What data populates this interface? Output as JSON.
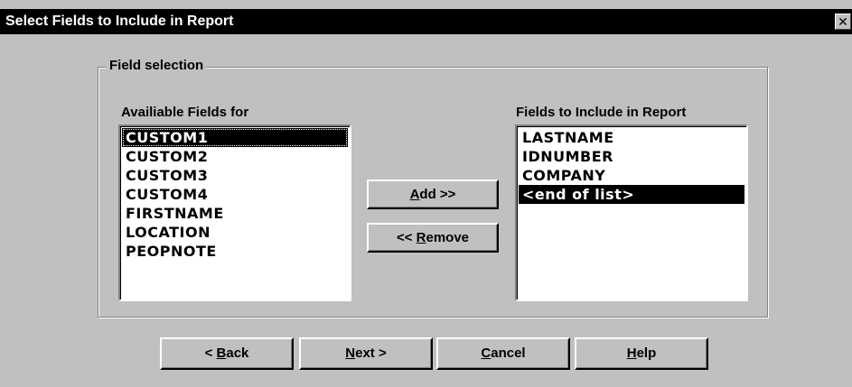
{
  "window": {
    "title": "Select Fields to Include in Report",
    "close_glyph": "✕"
  },
  "group": {
    "legend": "Field selection"
  },
  "available": {
    "label": "Availiable Fields for",
    "items": [
      "CUSTOM1",
      "CUSTOM2",
      "CUSTOM3",
      "CUSTOM4",
      "FIRSTNAME",
      "LOCATION",
      "PEOPNOTE"
    ],
    "selected_index": 0
  },
  "included": {
    "label": "Fields to Include in Report",
    "items": [
      "LASTNAME",
      "IDNUMBER",
      "COMPANY",
      "<end of list>"
    ],
    "selected_index": 3
  },
  "buttons": {
    "add": {
      "mnemonic": "A",
      "rest": "dd >>"
    },
    "remove": {
      "prefix": "<< ",
      "mnemonic": "R",
      "rest": "emove"
    },
    "back": {
      "prefix": "< ",
      "mnemonic": "B",
      "rest": "ack"
    },
    "next": {
      "mnemonic": "N",
      "rest": "ext >"
    },
    "cancel": {
      "mnemonic": "C",
      "rest": "ancel"
    },
    "help": {
      "mnemonic": "H",
      "rest": "elp"
    }
  },
  "colors": {
    "face": "#c0c0c0",
    "titlebar": "#000000",
    "selection": "#000000"
  }
}
